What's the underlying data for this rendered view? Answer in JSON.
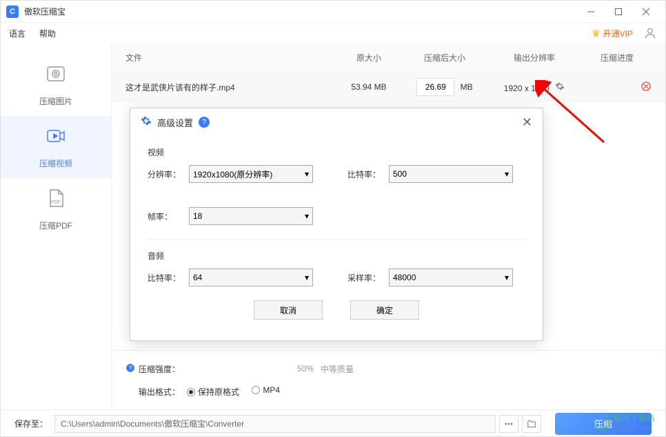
{
  "app": {
    "title": "傲软压缩宝",
    "icon_letter": "C"
  },
  "menu": {
    "language": "语言",
    "help": "帮助",
    "vip": "开通VIP"
  },
  "sidebar": {
    "items": [
      {
        "label": "压缩图片"
      },
      {
        "label": "压缩视频"
      },
      {
        "label": "压缩PDF"
      }
    ]
  },
  "table": {
    "headers": {
      "file": "文件",
      "size": "原大小",
      "after": "压缩后大小",
      "resolution": "输出分辨率",
      "progress": "压缩进度"
    },
    "row": {
      "filename": "这才是武侠片该有的样子.mp4",
      "original_size": "53.94 MB",
      "after_value": "26.69",
      "after_unit": "MB",
      "resolution": "1920 x 1080"
    }
  },
  "bottom": {
    "strength_label": "压缩强度：",
    "strength_value": "50%",
    "quality_label": "中等质量",
    "format_label": "输出格式：",
    "format_keep": "保持原格式",
    "format_mp4": "MP4"
  },
  "footer": {
    "save_label": "保存至：",
    "path": "C:\\Users\\admin\\Documents\\傲软压缩宝\\Converter",
    "compress_btn": "压缩"
  },
  "dialog": {
    "title": "高级设置",
    "video_section": "视频",
    "audio_section": "音频",
    "resolution_label": "分辨率：",
    "resolution_value": "1920x1080(原分辨率)",
    "bitrate_label": "比特率：",
    "video_bitrate_value": "500",
    "framerate_label": "帧率：",
    "framerate_value": "18",
    "audio_bitrate_value": "64",
    "samplerate_label": "采样率：",
    "samplerate_value": "48000",
    "cancel": "取消",
    "ok": "确定"
  },
  "watermark": {
    "name": "极光下载站",
    "url": "www.xz7.com"
  }
}
